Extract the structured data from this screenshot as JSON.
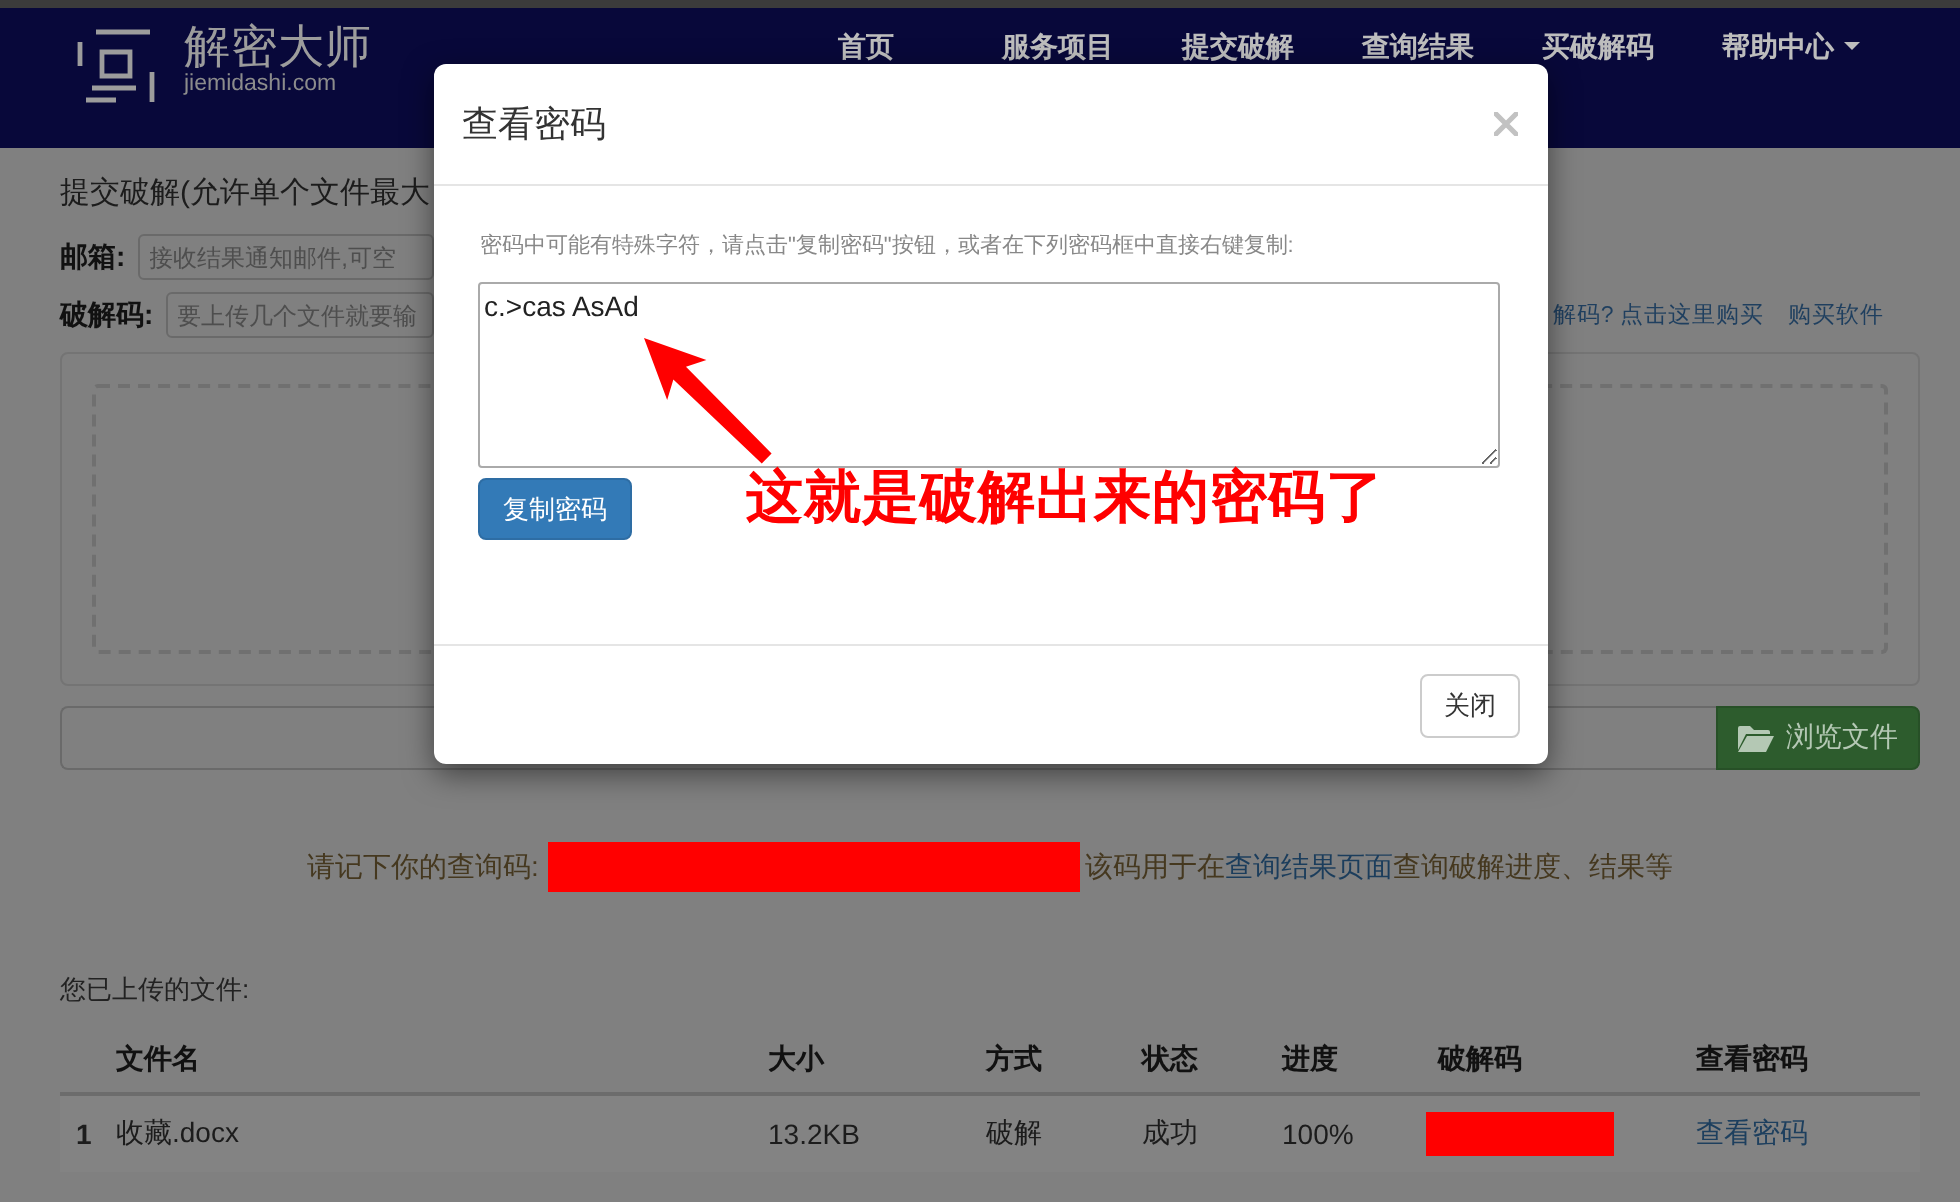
{
  "navbar": {
    "logo": {
      "title": "解密大师",
      "subtitle": "jiemidashi.com"
    },
    "items": [
      {
        "label": "首页",
        "dropdown": false
      },
      {
        "label": "服务项目",
        "dropdown": false
      },
      {
        "label": "提交破解",
        "dropdown": false
      },
      {
        "label": "查询结果",
        "dropdown": false
      },
      {
        "label": "买破解码",
        "dropdown": false
      },
      {
        "label": "帮助中心",
        "dropdown": true
      }
    ]
  },
  "submit_form": {
    "title": "提交破解(允许单个文件最大",
    "fields": [
      {
        "label": "邮箱:",
        "placeholder": "接收结果通知邮件,可空"
      },
      {
        "label": "破解码:",
        "placeholder": "要上传几个文件就要输"
      }
    ],
    "links": [
      "解码? 点击这里购买",
      "购买软件"
    ],
    "browse_button": "浏览文件"
  },
  "query_notice": {
    "label": "请记下你的查询码:",
    "text_before_link": "该码用于在",
    "link": "查询结果页面",
    "text_after_link": "查询破解进度、结果等"
  },
  "uploaded_files": {
    "title": "您已上传的文件:",
    "columns": [
      "文件名",
      "大小",
      "方式",
      "状态",
      "进度",
      "破解码",
      "查看密码"
    ],
    "rows": [
      {
        "index": "1",
        "file_name": "收藏.docx",
        "size": "13.2KB",
        "mode": "破解",
        "status": "成功",
        "progress": "100%",
        "action": "查看密码"
      }
    ]
  },
  "modal": {
    "title": "查看密码",
    "hint": "密码中可能有特殊字符，请点击\"复制密码\"按钮，或者在下列密码框中直接右键复制:",
    "password": "c.>cas AsAd",
    "copy_button": "复制密码",
    "close_button": "关闭"
  },
  "annotation": {
    "text": "这就是破解出来的密码了"
  }
}
